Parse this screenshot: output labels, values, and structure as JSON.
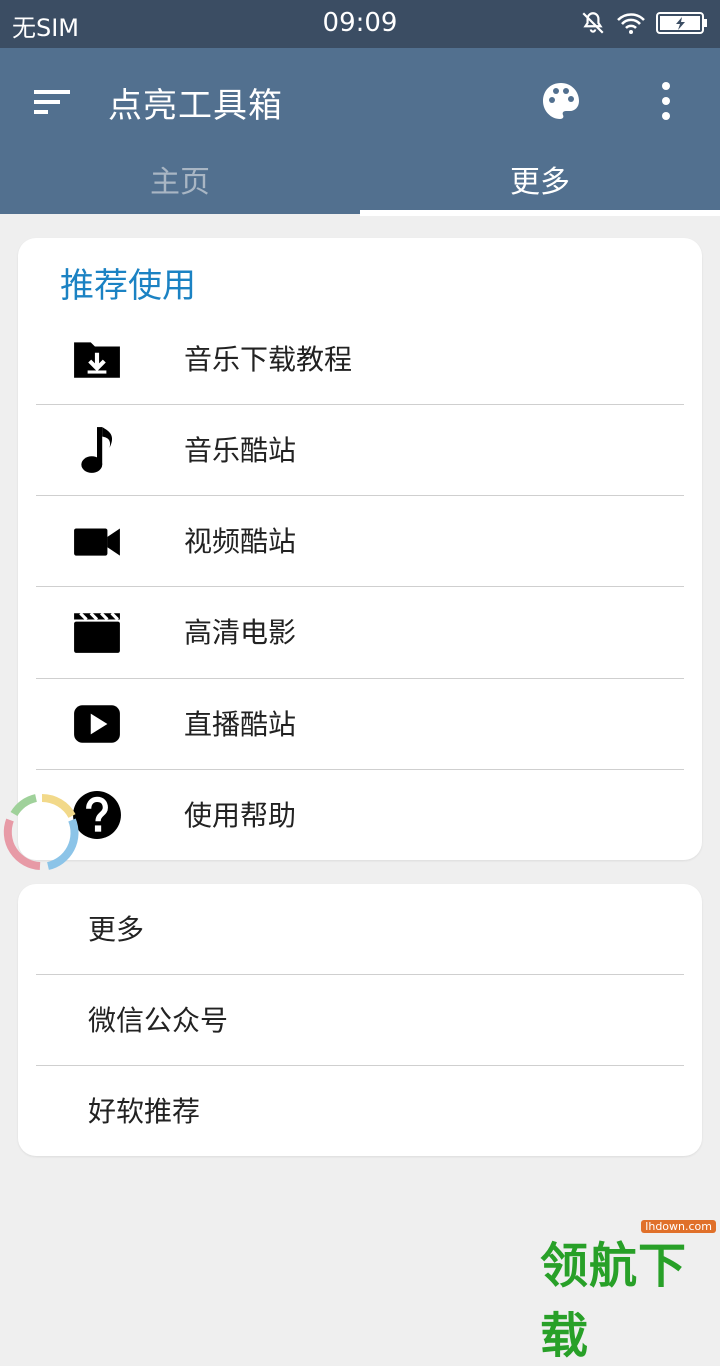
{
  "status": {
    "carrier": "无SIM",
    "time": "09:09"
  },
  "appbar": {
    "title": "点亮工具箱",
    "menu_icon": "sort-icon",
    "palette_icon": "palette-icon",
    "overflow_icon": "more-vert-icon"
  },
  "tabs": [
    {
      "label": "主页",
      "active": false
    },
    {
      "label": "更多",
      "active": true
    }
  ],
  "recommend": {
    "title": "推荐使用",
    "items": [
      {
        "label": "音乐下载教程",
        "icon": "folder-download-icon"
      },
      {
        "label": "音乐酷站",
        "icon": "music-note-icon"
      },
      {
        "label": "视频酷站",
        "icon": "videocam-icon"
      },
      {
        "label": "高清电影",
        "icon": "movie-icon"
      },
      {
        "label": "直播酷站",
        "icon": "play-icon"
      },
      {
        "label": "使用帮助",
        "icon": "help-icon"
      }
    ]
  },
  "more": {
    "items": [
      {
        "label": "更多"
      },
      {
        "label": "微信公众号"
      },
      {
        "label": "好软推荐"
      }
    ]
  },
  "watermark": {
    "text": "领航下载",
    "url": "lhdown.com"
  },
  "colors": {
    "statusbar": "#3b4d63",
    "appbar": "#52708f",
    "accent": "#1b82c3",
    "background": "#efefef"
  }
}
